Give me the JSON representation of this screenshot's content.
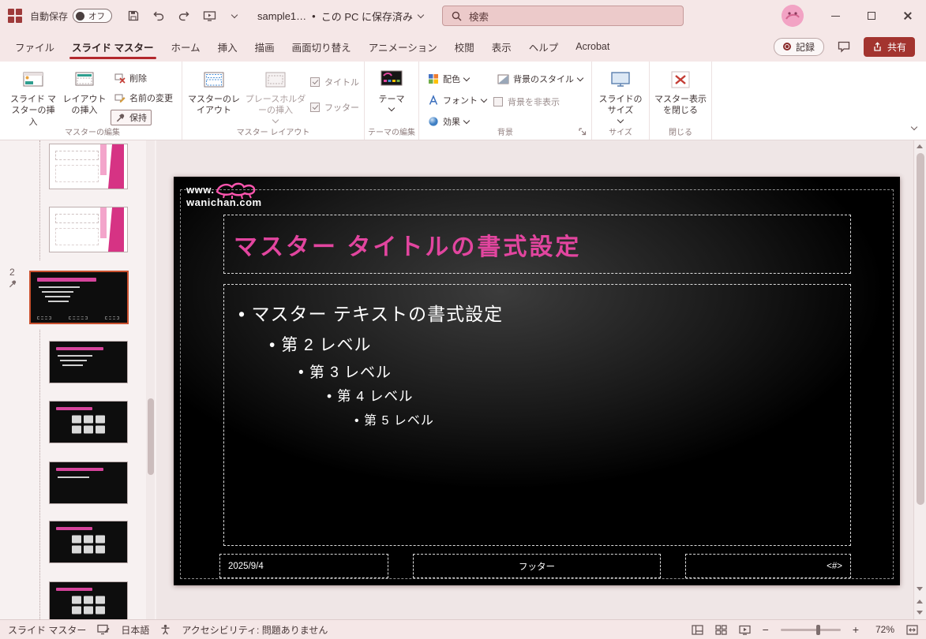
{
  "titlebar": {
    "autosave_label": "自動保存",
    "autosave_state": "オフ",
    "filename": "sample1…",
    "separator": "•",
    "file_status": "この PC に保存済み",
    "search_label": "検索"
  },
  "tabs": [
    {
      "label": "ファイル"
    },
    {
      "label": "スライド マスター"
    },
    {
      "label": "ホーム"
    },
    {
      "label": "挿入"
    },
    {
      "label": "描画"
    },
    {
      "label": "画面切り替え"
    },
    {
      "label": "アニメーション"
    },
    {
      "label": "校閲"
    },
    {
      "label": "表示"
    },
    {
      "label": "ヘルプ"
    },
    {
      "label": "Acrobat"
    }
  ],
  "tab_actions": {
    "record": "記録",
    "share": "共有"
  },
  "ribbon": {
    "groups": [
      "マスターの編集",
      "マスター レイアウト",
      "テーマの編集",
      "背景",
      "サイズ",
      "閉じる"
    ],
    "insert_slide_master": "スライド マスターの挿入",
    "insert_layout": "レイアウトの挿入",
    "delete": "削除",
    "rename": "名前の変更",
    "preserve": "保持",
    "master_layout": "マスターのレイアウト",
    "insert_placeholder": "プレースホルダーの挿入",
    "title_cb": "タイトル",
    "footer_cb": "フッター",
    "themes": "テーマ",
    "colors": "配色",
    "fonts": "フォント",
    "effects": "効果",
    "background_styles": "背景のスタイル",
    "hide_background": "背景を非表示",
    "slide_size": "スライドのサイズ",
    "close_master": "マスター表示を閉じる"
  },
  "thumbnails": {
    "slide_number": "2"
  },
  "slide": {
    "logo_line1": "www.",
    "logo_line2": "wanichan.com",
    "title_placeholder": "マスター タイトルの書式設定",
    "body_lines": [
      "• マスター テキストの書式設定",
      "• 第 2 レベル",
      "• 第 3 レベル",
      "• 第 4 レベル",
      "• 第 5 レベル"
    ],
    "date": "2025/9/4",
    "footer": "フッター",
    "slide_number": "<#>"
  },
  "statusbar": {
    "view_label": "スライド マスター",
    "language": "日本語",
    "accessibility": "アクセシビリティ: 問題ありません",
    "zoom_out": "−",
    "zoom_in": "+",
    "zoom": "72%"
  }
}
